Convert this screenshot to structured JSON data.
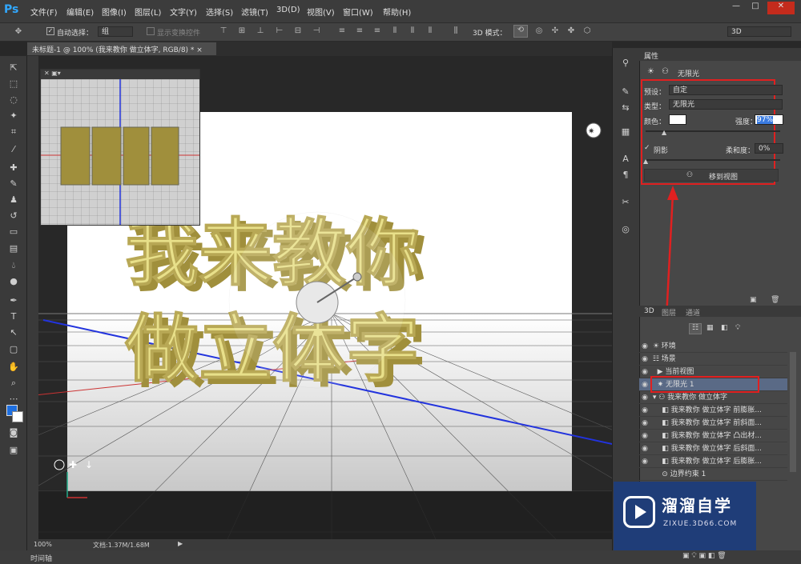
{
  "app": {
    "logo": "Ps"
  },
  "menu": [
    "文件(F)",
    "编辑(E)",
    "图像(I)",
    "图层(L)",
    "文字(Y)",
    "选择(S)",
    "滤镜(T)",
    "3D(D)",
    "视图(V)",
    "窗口(W)",
    "帮助(H)"
  ],
  "window_controls": [
    "—",
    "□",
    "✕"
  ],
  "options": {
    "auto_select_label": "自动选择：",
    "auto_select_value": "组",
    "show_transform": "显示变换控件",
    "mode_3d": "3D 模式：",
    "workspace": "3D"
  },
  "document": {
    "tab_title": "未标题-1 @ 100% (我来教你 做立体字, RGB/8) *",
    "close": "×",
    "zoom": "100%",
    "doc_info": "文档:1.37M/1.68M",
    "text_line1": "我来教你",
    "text_line2": "做立体字"
  },
  "timeline": {
    "label": "时间轴"
  },
  "properties": {
    "tab": "属性",
    "header": "无限光",
    "preset_label": "预设：",
    "preset_value": "自定",
    "type_label": "类型：",
    "type_value": "无限光",
    "color_label": "颜色：",
    "intensity_label": "强度：",
    "intensity_value": "97%",
    "shadow_label": "阴影",
    "softness_label": "柔和度：",
    "softness_value": "0%",
    "move_to_view": "移到视图"
  },
  "layers": {
    "tabs": [
      "3D",
      "图层",
      "通道"
    ],
    "rows": [
      "环境",
      "场景",
      "当前视图",
      "无限光 1",
      "我来教你 做立体字",
      "我来教你 做立体字 前膨胀...",
      "我来教你 做立体字 前斜面...",
      "我来教你 做立体字 凸出材...",
      "我来教你 做立体字 后斜面...",
      "我来教你 做立体字 后膨胀...",
      "边界约束 1"
    ]
  },
  "watermark": {
    "title": "溜溜自学",
    "url": "ZIXUE.3D66.COM"
  },
  "colors": {
    "accent": "#31a8ff",
    "highlight": "#e02020",
    "text_yellow": "#e8e08a",
    "text_side": "#a08f3c",
    "selected_row": "#5a6a86"
  }
}
